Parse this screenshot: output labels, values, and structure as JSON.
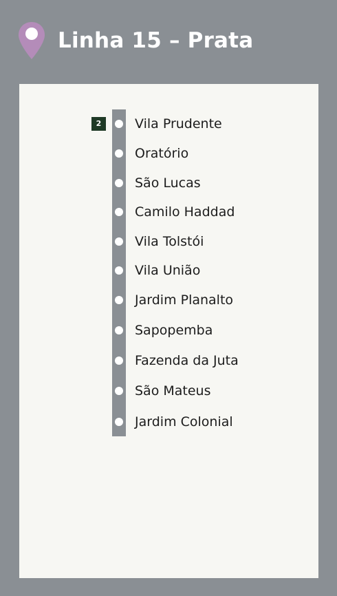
{
  "header": {
    "title": "Linha 15 – Prata",
    "icon": "location-pin-icon",
    "pin_color": "#b48cb9"
  },
  "colors": {
    "background": "#8a8f94",
    "panel": "#f7f7f3",
    "line_track": "#8a8f94",
    "connection_badge": "#1f3a26"
  },
  "stations": [
    {
      "name": "Vila Prudente",
      "connection": "2"
    },
    {
      "name": "Oratório"
    },
    {
      "name": "São Lucas"
    },
    {
      "name": "Camilo Haddad"
    },
    {
      "name": "Vila Tolstói"
    },
    {
      "name": "Vila União"
    },
    {
      "name": "Jardim Planalto"
    },
    {
      "name": "Sapopemba"
    },
    {
      "name": "Fazenda da Juta"
    },
    {
      "name": "São Mateus"
    },
    {
      "name": "Jardim Colonial"
    }
  ]
}
